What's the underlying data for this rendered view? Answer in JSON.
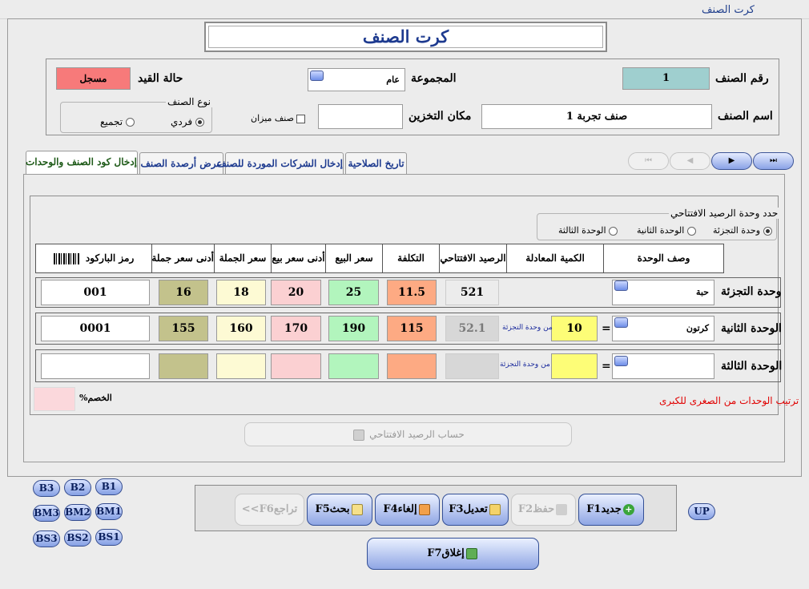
{
  "window": {
    "title": "كرت الصنف"
  },
  "heading": "كرت الصنف",
  "header": {
    "item_no_label": "رقم الصنف",
    "item_no_value": "1",
    "group_label": "المجموعة",
    "group_value": "عام",
    "status_label": "حالة القيد",
    "status_value": "مسجل",
    "item_name_label": "اسم الصنف",
    "item_name_value": "صنف تجربة 1",
    "storage_label": "مكان التخزين",
    "storage_value": "",
    "scale_item_label": "صنف ميزان",
    "item_type_title": "نوع الصنف",
    "item_type_options": [
      "فردي",
      "تجميع"
    ],
    "item_type_selected": "فردي"
  },
  "tabs": [
    {
      "label": "إدخال كود الصنف والوحدات",
      "active": true
    },
    {
      "label": "عرض أرصدة الصنف",
      "active": false
    },
    {
      "label": "إدخال الشركات الموردة للصنف",
      "active": false
    },
    {
      "label": "تاريخ الصلاحية",
      "active": false
    }
  ],
  "nav_buttons": [
    "⏮",
    "◀",
    "▶",
    "⏭"
  ],
  "opening_unit": {
    "title": "حدد وحدة الرصيد الافتتاحي",
    "options": [
      "وحدة التجزئة",
      "الوحدة الثانية",
      "الوحدة الثالثة"
    ],
    "selected": "وحدة التجزئة"
  },
  "table_headers": [
    "وصف الوحدة",
    "الكمية المعادلة",
    "الرصيد الافتتاحي",
    "التكلفة",
    "سعر البيع",
    "أدنى سعر بيع",
    "سعر الجملة",
    "أدنى سعر جملة",
    "رمز الباركود"
  ],
  "rows": [
    {
      "label": "وحدة التجزئة",
      "unit": "حبة",
      "eq_qty": "",
      "eq_note": "",
      "opening": "521",
      "cost": "11.5",
      "sale": "25",
      "min_sale": "20",
      "wholesale": "18",
      "min_wholesale": "16",
      "barcode": "001"
    },
    {
      "label": "الوحدة الثانية",
      "unit": "كرتون",
      "eq_qty": "10",
      "eq_note": "من وحدة التجزئة",
      "opening": "52.1",
      "cost": "115",
      "sale": "190",
      "min_sale": "170",
      "wholesale": "160",
      "min_wholesale": "155",
      "barcode": "0001"
    },
    {
      "label": "الوحدة الثالثة",
      "unit": "",
      "eq_qty": "",
      "eq_note": "من وحدة التجزئة",
      "opening": "",
      "cost": "",
      "sale": "",
      "min_sale": "",
      "wholesale": "",
      "min_wholesale": "",
      "barcode": ""
    }
  ],
  "equals_sign": "=",
  "units_order_note": "ترتيب الوحدات من الصغرى للكبرى",
  "discount_label": "الخصم%",
  "discount_value": "",
  "calc_opening_button": "حساب الرصيد الافتتاحي",
  "side_buttons": {
    "row1": [
      "B3",
      "B2",
      "B1"
    ],
    "row2": [
      "BM3",
      "BM2",
      "BM1"
    ],
    "row3": [
      "BS3",
      "BS2",
      "BS1"
    ]
  },
  "up_button": "UP",
  "function_buttons": {
    "new": "جديدF1",
    "save": "حفظF2",
    "edit": "تعديلF3",
    "cancel": "إلغاءF4",
    "search": "بحثF5",
    "back": "تراجعF6>>",
    "close": "إغلاقF7"
  },
  "colors": {
    "status_bg": "#f77a7a",
    "item_no_bg": "#9fcfcf",
    "opening_bg": "#ececec",
    "cost_bg": "#fdaa83",
    "sale_bg": "#b2f5bd",
    "min_sale_bg": "#fbd0d2",
    "wholesale_bg": "#fdfad4",
    "min_wholesale_bg": "#c3c28c",
    "eq_qty_bg": "#fdfd77",
    "note_red": "#e00000"
  }
}
